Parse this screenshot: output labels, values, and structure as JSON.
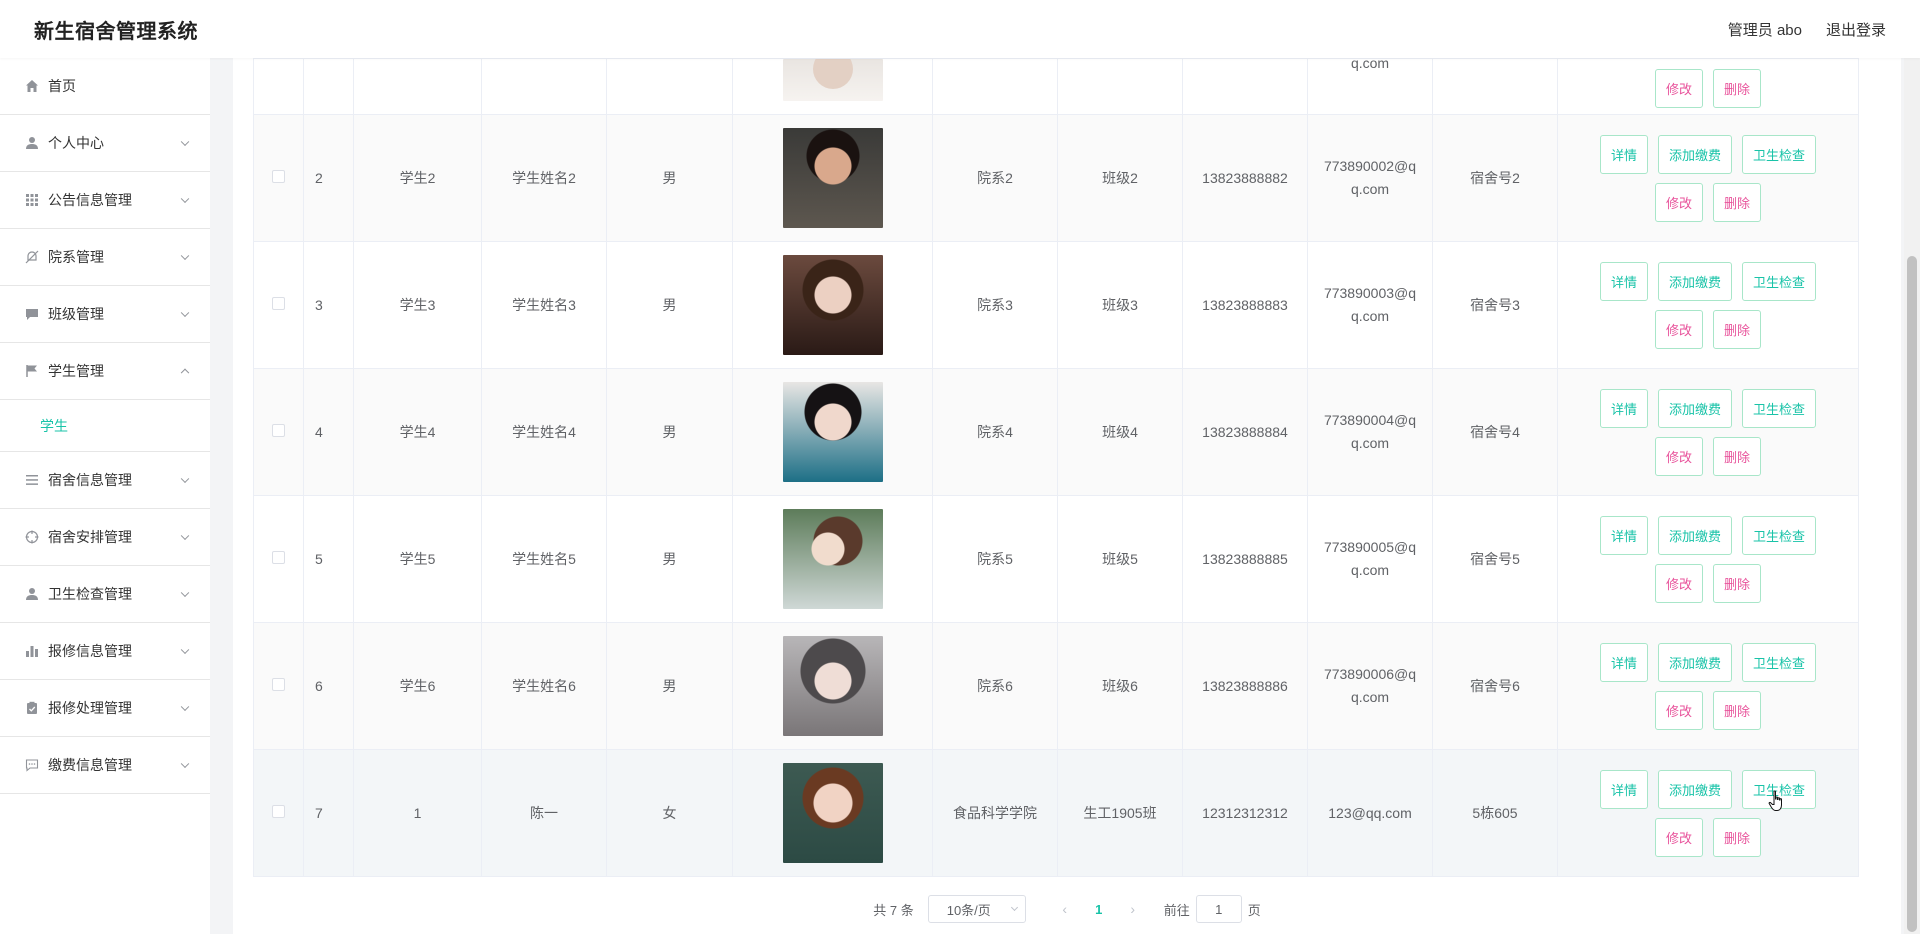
{
  "header": {
    "title": "新生宿舍管理系统",
    "admin": "管理员 abo",
    "logout": "退出登录"
  },
  "sidebar": {
    "items": [
      {
        "label": "首页",
        "icon": "home-icon"
      },
      {
        "label": "个人中心",
        "icon": "user-icon"
      },
      {
        "label": "公告信息管理",
        "icon": "grid-icon"
      },
      {
        "label": "院系管理",
        "icon": "bell-off-icon"
      },
      {
        "label": "班级管理",
        "icon": "chat-icon"
      },
      {
        "label": "学生管理",
        "icon": "flag-icon",
        "expanded": true
      },
      {
        "label": "宿舍信息管理",
        "icon": "menu-icon"
      },
      {
        "label": "宿舍安排管理",
        "icon": "target-icon"
      },
      {
        "label": "卫生检查管理",
        "icon": "user-icon"
      },
      {
        "label": "报修信息管理",
        "icon": "bar-chart-icon"
      },
      {
        "label": "报修处理管理",
        "icon": "clipboard-icon"
      },
      {
        "label": "缴费信息管理",
        "icon": "message-icon"
      }
    ],
    "sub_item": "学生",
    "accent_color": "#19c3a8"
  },
  "partial_row": {
    "email_tail": "q.com"
  },
  "rows": [
    {
      "index": "2",
      "account": "学生2",
      "name": "学生姓名2",
      "gender": "男",
      "dept": "院系2",
      "class": "班级2",
      "phone": "13823888882",
      "email_a": "773890002@q",
      "email_b": "q.com",
      "dorm": "宿舍号2"
    },
    {
      "index": "3",
      "account": "学生3",
      "name": "学生姓名3",
      "gender": "男",
      "dept": "院系3",
      "class": "班级3",
      "phone": "13823888883",
      "email_a": "773890003@q",
      "email_b": "q.com",
      "dorm": "宿舍号3"
    },
    {
      "index": "4",
      "account": "学生4",
      "name": "学生姓名4",
      "gender": "男",
      "dept": "院系4",
      "class": "班级4",
      "phone": "13823888884",
      "email_a": "773890004@q",
      "email_b": "q.com",
      "dorm": "宿舍号4"
    },
    {
      "index": "5",
      "account": "学生5",
      "name": "学生姓名5",
      "gender": "男",
      "dept": "院系5",
      "class": "班级5",
      "phone": "13823888885",
      "email_a": "773890005@q",
      "email_b": "q.com",
      "dorm": "宿舍号5"
    },
    {
      "index": "6",
      "account": "学生6",
      "name": "学生姓名6",
      "gender": "男",
      "dept": "院系6",
      "class": "班级6",
      "phone": "13823888886",
      "email_a": "773890006@q",
      "email_b": "q.com",
      "dorm": "宿舍号6"
    },
    {
      "index": "7",
      "account": "1",
      "name": "陈一",
      "gender": "女",
      "dept": "食品科学学院",
      "class": "生工1905班",
      "phone": "12312312312",
      "email_a": "123@qq.com",
      "email_b": "",
      "dorm": "5栋605"
    }
  ],
  "actions": {
    "detail": "详情",
    "add_fee": "添加缴费",
    "hygiene": "卫生检查",
    "edit": "修改",
    "delete": "删除"
  },
  "pagination": {
    "total": "共 7 条",
    "page_size": "10条/页",
    "current_page": "1",
    "goto_prefix": "前往",
    "goto_value": "1",
    "goto_suffix": "页"
  },
  "colors": {
    "button_green": "#19c3a8",
    "button_red": "#e8539b",
    "button_border": "#a8e6c9"
  }
}
